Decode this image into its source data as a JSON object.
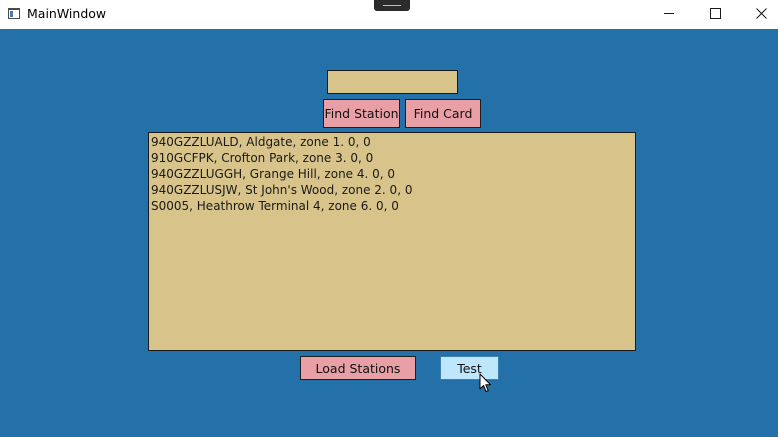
{
  "window": {
    "title": "MainWindow"
  },
  "search": {
    "value": ""
  },
  "buttons": {
    "find_station": "Find Station",
    "find_card": "Find Card",
    "load_stations": "Load Stations",
    "test": "Test"
  },
  "output": {
    "lines": [
      "940GZZLUALD, Aldgate, zone 1. 0, 0",
      "910GCFPK, Crofton Park, zone 3. 0, 0",
      "940GZZLUGGH, Grange Hill, zone 4. 0, 0",
      "940GZZLUSJW, St John's Wood, zone 2. 0, 0",
      "S0005, Heathrow Terminal 4, zone 6. 0, 0"
    ]
  },
  "colors": {
    "background": "#2470a8",
    "field": "#d8c48a",
    "button_pink": "#e8a0a6",
    "button_hover": "#bee6fd"
  },
  "icons": {
    "app": "app-window-icon",
    "minimize": "minimize-icon",
    "maximize": "maximize-icon",
    "close": "close-icon",
    "cursor": "mouse-pointer-icon"
  }
}
